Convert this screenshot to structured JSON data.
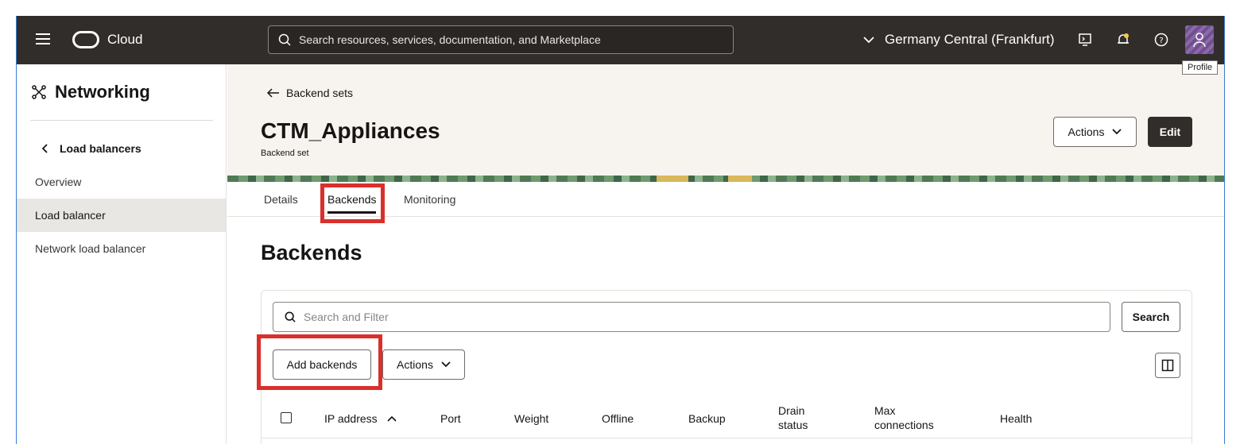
{
  "topbar": {
    "brand": "Cloud",
    "search_placeholder": "Search resources, services, documentation, and Marketplace",
    "region": "Germany Central (Frankfurt)",
    "tooltip": "Profile"
  },
  "sidebar": {
    "title": "Networking",
    "back_label": "Load balancers",
    "items": [
      {
        "label": "Overview"
      },
      {
        "label": "Load balancer"
      },
      {
        "label": "Network load balancer"
      }
    ]
  },
  "header": {
    "back_link": "Backend sets",
    "title": "CTM_Appliances",
    "subtitle": "Backend set",
    "actions_label": "Actions",
    "edit_label": "Edit"
  },
  "tabs": [
    {
      "label": "Details"
    },
    {
      "label": "Backends"
    },
    {
      "label": "Monitoring"
    }
  ],
  "backends": {
    "title": "Backends",
    "search_placeholder": "Search and Filter",
    "search_button": "Search",
    "add_button": "Add backends",
    "actions_label": "Actions",
    "columns": [
      "IP address",
      "Port",
      "Weight",
      "Offline",
      "Backup",
      "Drain status",
      "Max connections",
      "Health"
    ]
  },
  "colors": {
    "topbar": "#312d2a",
    "hero": "#f7f3ef",
    "highlight": "#d9302c",
    "sidebar_active": "#e9e7e4"
  }
}
